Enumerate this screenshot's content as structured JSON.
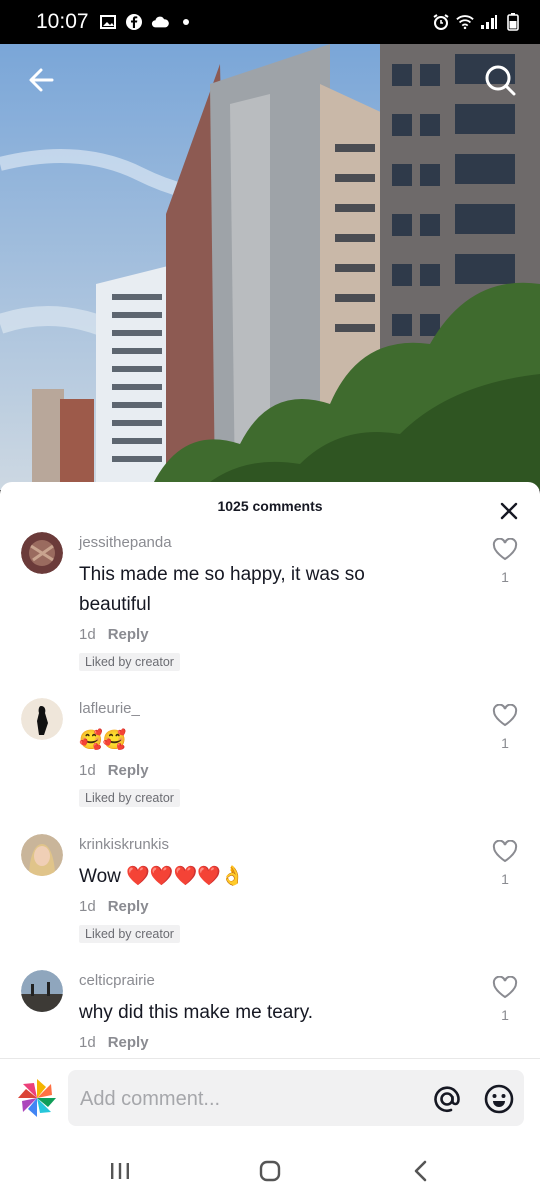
{
  "status_bar": {
    "time": "10:07",
    "icons": [
      "image-icon",
      "facebook-icon",
      "cloud-icon",
      "dot-icon",
      "alarm-icon",
      "wifi-icon",
      "signal-icon",
      "battery-icon"
    ]
  },
  "video_nav": {
    "back_icon": "back-arrow-icon",
    "search_icon": "search-icon"
  },
  "comments_sheet": {
    "title": "1025 comments",
    "comments": [
      {
        "username": "jessithepanda",
        "text": "This made me so happy, it was so beautiful",
        "age": "1d",
        "reply_label": "Reply",
        "liked_badge": "Liked by creator",
        "likes": "1"
      },
      {
        "username": "lafleurie_",
        "text": "🥰🥰",
        "age": "1d",
        "reply_label": "Reply",
        "liked_badge": "Liked by creator",
        "likes": "1"
      },
      {
        "username": "krinkiskrunkis",
        "text": "Wow ❤️❤️❤️❤️👌",
        "age": "1d",
        "reply_label": "Reply",
        "liked_badge": "Liked by creator",
        "likes": "1"
      },
      {
        "username": "celticprairie",
        "text": "why did this make me teary.",
        "age": "1d",
        "reply_label": "Reply",
        "likes": "1"
      }
    ]
  },
  "composer": {
    "placeholder": "Add comment...",
    "mention_icon": "at-icon",
    "emoji_icon": "emoji-icon"
  },
  "colors": {
    "text": "#161823",
    "muted": "#8a8b91",
    "badge_bg": "#f1f1f2"
  }
}
